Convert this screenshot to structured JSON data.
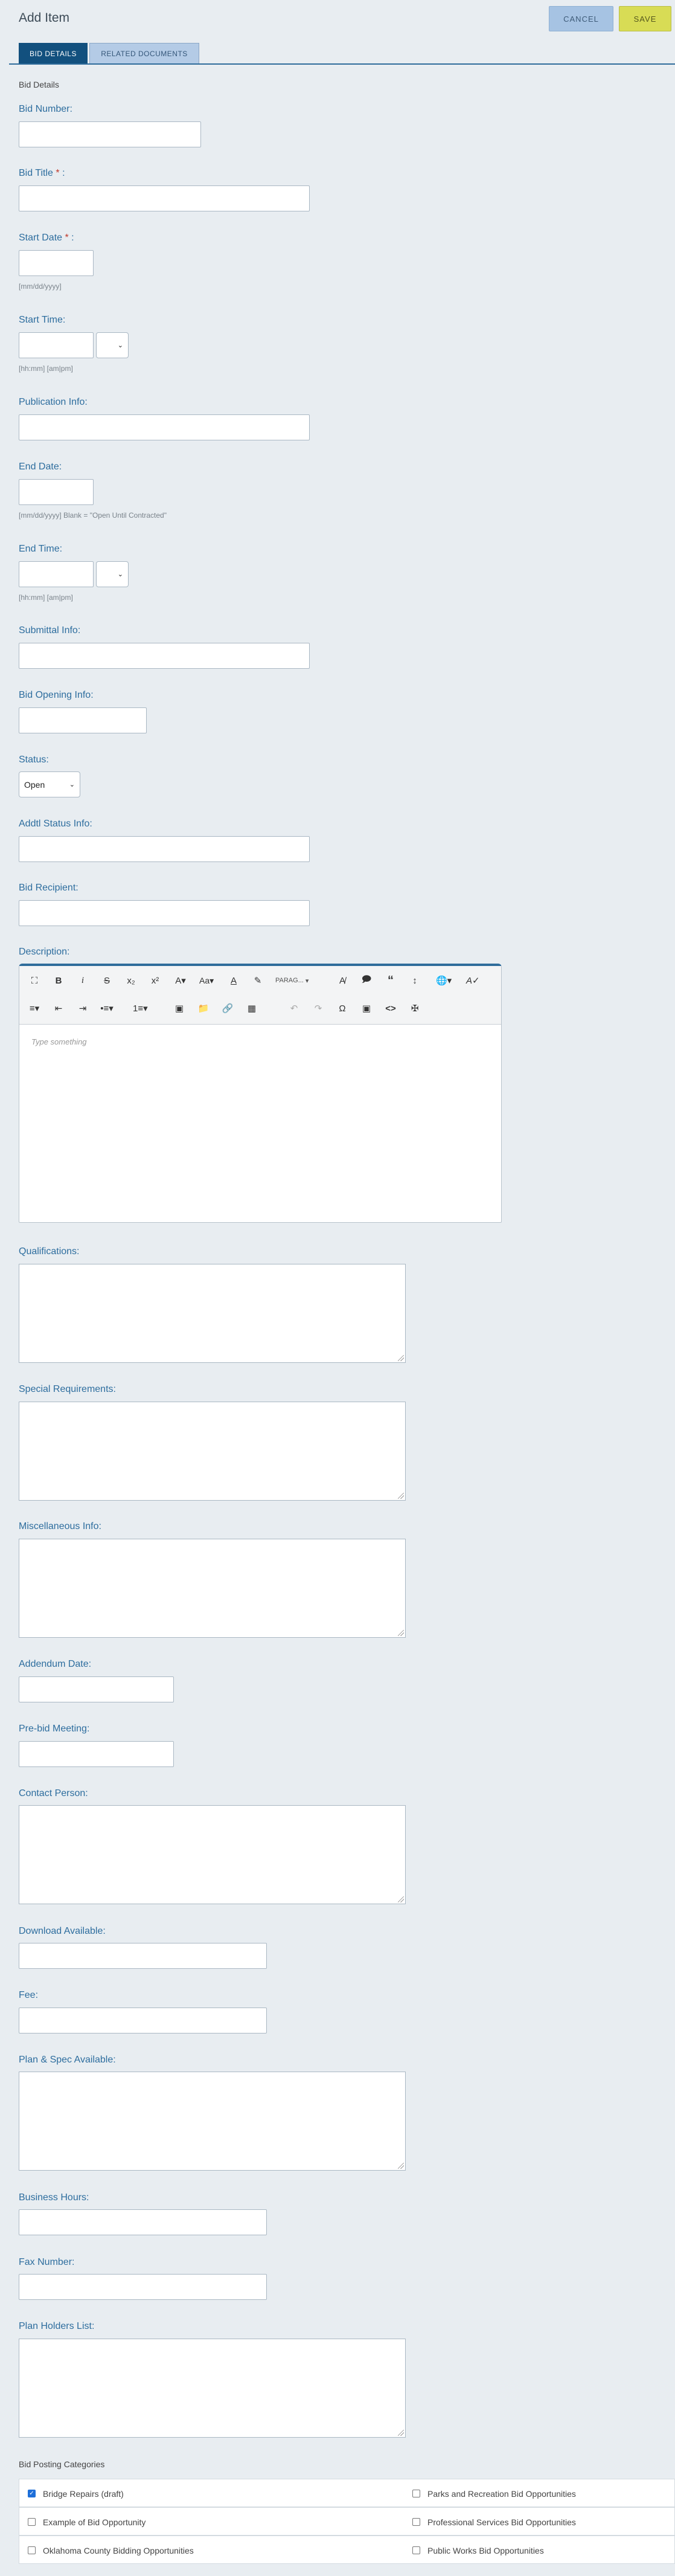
{
  "header": {
    "title": "Add Item",
    "cancel_label": "CANCEL",
    "save_label": "SAVE"
  },
  "tabs": [
    {
      "label": "BID DETAILS",
      "active": true
    },
    {
      "label": "RELATED DOCUMENTS",
      "active": false
    }
  ],
  "section_caption": "Bid Details",
  "fields": {
    "bid_number": "Bid Number:",
    "bid_title": "Bid Title",
    "start_date": "Start Date",
    "start_date_hint": "[mm/dd/yyyy]",
    "start_time": "Start Time:",
    "start_time_hint": "[hh:mm] [am|pm]",
    "publication_info": "Publication Info:",
    "end_date": "End Date:",
    "end_date_hint": "[mm/dd/yyyy] Blank = \"Open Until Contracted\"",
    "end_time": "End Time:",
    "end_time_hint": "[hh:mm] [am|pm]",
    "submittal_info": "Submittal Info:",
    "bid_opening_info": "Bid Opening Info:",
    "status": "Status:",
    "status_value": "Open",
    "addtl_status_info": "Addtl Status Info:",
    "bid_recipient": "Bid Recipient:",
    "description": "Description:",
    "qualifications": "Qualifications:",
    "special_requirements": "Special Requirements:",
    "miscellaneous_info": "Miscellaneous Info:",
    "addendum_date": "Addendum Date:",
    "pre_bid_meeting": "Pre-bid Meeting:",
    "contact_person": "Contact Person:",
    "download_available": "Download Available:",
    "fee": "Fee:",
    "plan_spec_available": "Plan & Spec Available:",
    "business_hours": "Business Hours:",
    "fax_number": "Fax Number:",
    "plan_holders_list": "Plan Holders List:"
  },
  "required_mark": "*",
  "label_colon": ":",
  "editor": {
    "placeholder": "Type something",
    "paragraph_label": "PARAG..."
  },
  "categories": {
    "caption": "Bid Posting Categories",
    "items": [
      {
        "label": "Bridge Repairs (draft)",
        "checked": true
      },
      {
        "label": "Parks and Recreation Bid Opportunities",
        "checked": false
      },
      {
        "label": "Example of Bid Opportunity",
        "checked": false
      },
      {
        "label": "Professional Services Bid Opportunities",
        "checked": false
      },
      {
        "label": "Oklahoma County Bidding Opportunities",
        "checked": false
      },
      {
        "label": "Public Works Bid Opportunities",
        "checked": false
      }
    ]
  },
  "colors": {
    "accent": "#2f6c9b",
    "label": "#2d6d9e",
    "save": "#d8dc55",
    "cancel": "#a6c3e3",
    "background": "#e8edf1"
  }
}
